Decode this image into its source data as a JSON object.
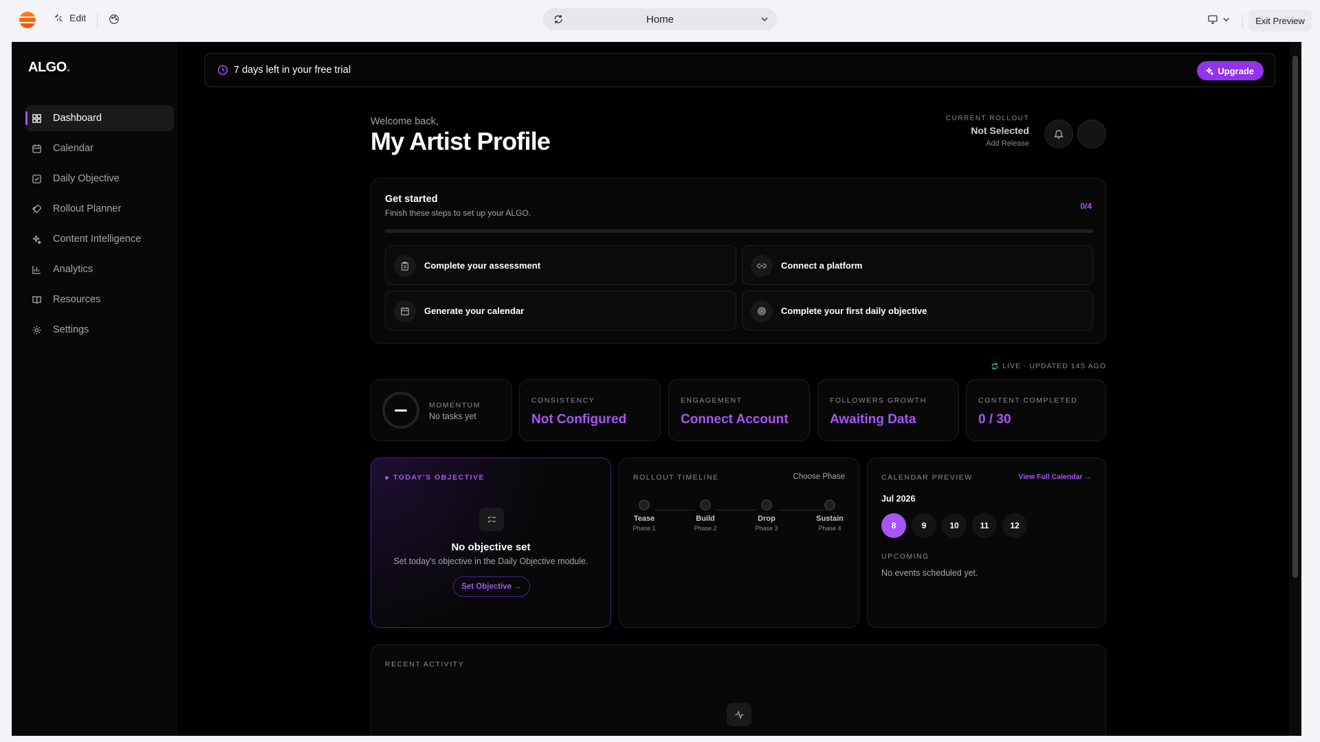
{
  "editor": {
    "edit_label": "Edit",
    "page_select": "Home",
    "exit_label": "Exit Preview"
  },
  "brand": {
    "name": "ALGO",
    "dot": "."
  },
  "sidebar": {
    "items": [
      {
        "label": "Dashboard",
        "icon": "grid-icon"
      },
      {
        "label": "Calendar",
        "icon": "calendar-icon"
      },
      {
        "label": "Daily Objective",
        "icon": "check-square-icon"
      },
      {
        "label": "Rollout Planner",
        "icon": "rocket-icon"
      },
      {
        "label": "Content Intelligence",
        "icon": "sparkles-icon"
      },
      {
        "label": "Analytics",
        "icon": "bar-chart-icon"
      },
      {
        "label": "Resources",
        "icon": "book-icon"
      },
      {
        "label": "Settings",
        "icon": "gear-icon"
      }
    ]
  },
  "trial": {
    "text": "7 days left in your free trial",
    "upgrade_label": "Upgrade"
  },
  "header": {
    "welcome": "Welcome back,",
    "title": "My Artist Profile",
    "rollout_key": "CURRENT ROLLOUT",
    "rollout_value": "Not Selected",
    "rollout_action": "Add Release"
  },
  "get_started": {
    "title": "Get started",
    "subtitle": "Finish these steps to set up your ALGO.",
    "count": "0/4",
    "progress": 0,
    "steps": [
      {
        "label": "Complete your assessment",
        "icon": "clipboard-icon"
      },
      {
        "label": "Connect a platform",
        "icon": "link-icon"
      },
      {
        "label": "Generate your calendar",
        "icon": "calendar-icon"
      },
      {
        "label": "Complete your first daily objective",
        "icon": "target-icon"
      }
    ]
  },
  "live": "LIVE · UPDATED 14S AGO",
  "metrics": {
    "momentum": {
      "key": "MOMENTUM",
      "value": "No tasks yet"
    },
    "consistency": {
      "key": "CONSISTENCY",
      "value": "Not Configured"
    },
    "engagement": {
      "key": "ENGAGEMENT",
      "value": "Connect Account"
    },
    "followers": {
      "key": "FOLLOWERS GROWTH",
      "value": "Awaiting Data"
    },
    "content": {
      "key": "CONTENT COMPLETED",
      "value": "0 / 30"
    }
  },
  "objective": {
    "key": "TODAY'S OBJECTIVE",
    "title": "No objective set",
    "desc": "Set today's objective in the Daily Objective module.",
    "button": "Set Objective →"
  },
  "timeline": {
    "key": "ROLLOUT TIMELINE",
    "choose": "Choose Phase",
    "phases": [
      {
        "name": "Tease",
        "sub": "Phase 1"
      },
      {
        "name": "Build",
        "sub": "Phase 2"
      },
      {
        "name": "Drop",
        "sub": "Phase 3"
      },
      {
        "name": "Sustain",
        "sub": "Phase 4"
      }
    ]
  },
  "calendar": {
    "key": "CALENDAR PREVIEW",
    "view_full": "View Full Calendar →",
    "month": "Jul 2026",
    "days": [
      "8",
      "9",
      "10",
      "11",
      "12"
    ],
    "upcoming_key": "UPCOMING",
    "upcoming_empty": "No events scheduled yet."
  },
  "recent": {
    "key": "RECENT ACTIVITY"
  },
  "colors": {
    "accent": "#a855f7",
    "upgrade": "#9333ea",
    "background": "#000000"
  }
}
